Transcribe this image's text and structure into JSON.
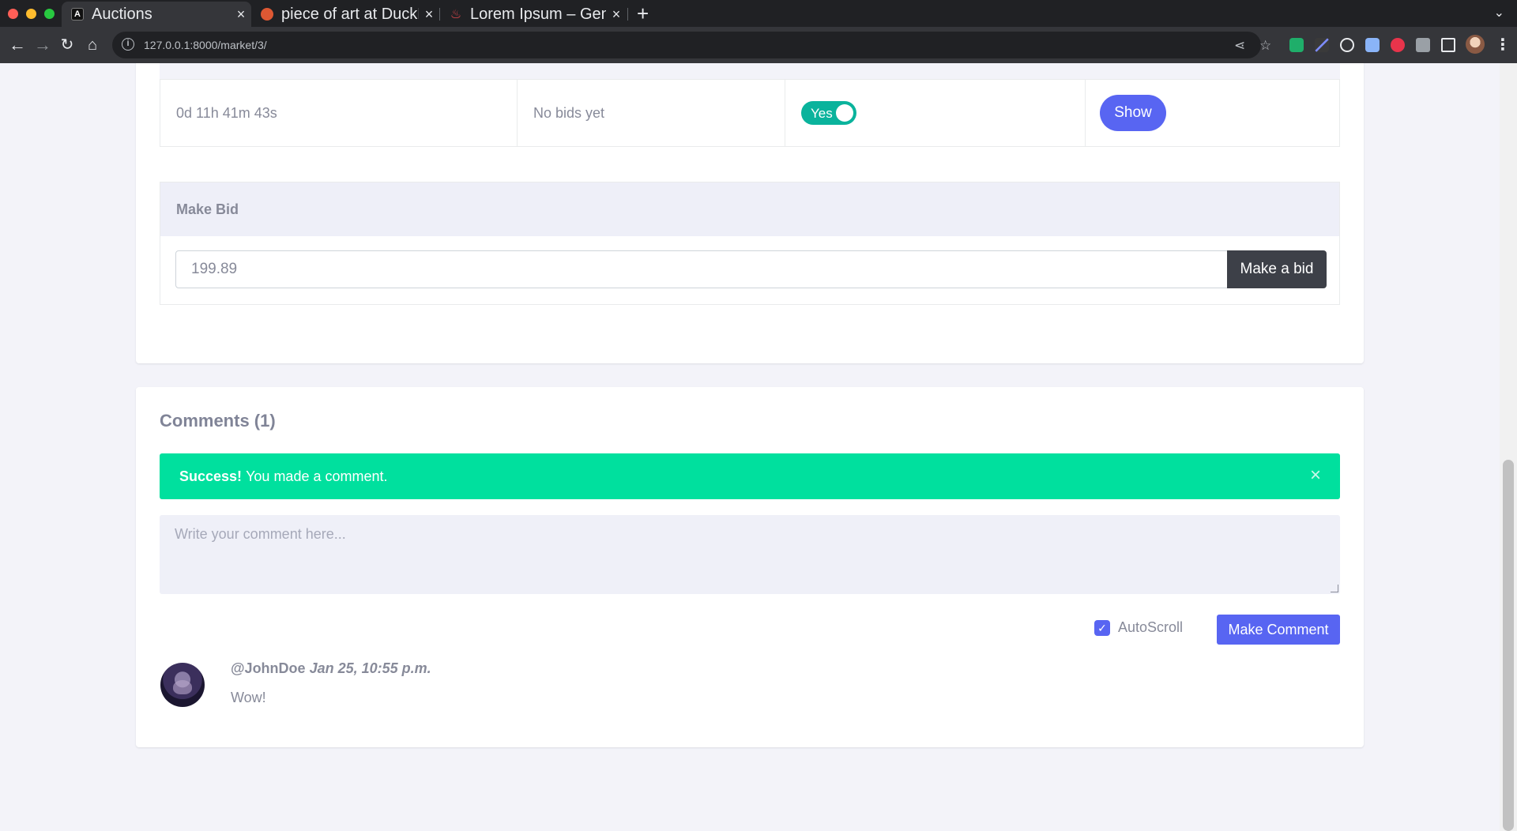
{
  "browser": {
    "tabs": [
      {
        "title": "Auctions",
        "favicon": "auctions-favicon",
        "active": true
      },
      {
        "title": "piece of art at DuckDuckGo",
        "favicon": "duckduckgo-favicon",
        "active": false
      },
      {
        "title": "Lorem Ipsum – Generator",
        "favicon": "lipsum-favicon",
        "active": false
      }
    ],
    "url": "127.0.0.1:8000/market/3/",
    "new_tab": "+",
    "close_glyph": "×"
  },
  "listing": {
    "time_left": "0d 11h 41m 43s",
    "bids": "No bids yet",
    "active_label": "Yes",
    "show_button": "Show"
  },
  "bid": {
    "title": "Make Bid",
    "amount": "199.89",
    "submit": "Make a bid"
  },
  "comments": {
    "title": "Comments (1)",
    "alert_strong": "Success!",
    "alert_text": "You made a comment.",
    "placeholder": "Write your comment here...",
    "autoscroll": "AutoScroll",
    "submit": "Make Comment",
    "items": [
      {
        "author": "@JohnDoe",
        "date": "Jan 25, 10:55 p.m.",
        "text": "Wow!"
      }
    ]
  },
  "colors": {
    "primary": "#5865f2",
    "success": "#00e09e",
    "toggle": "#0ab39c",
    "dark_button": "#3d4048"
  }
}
